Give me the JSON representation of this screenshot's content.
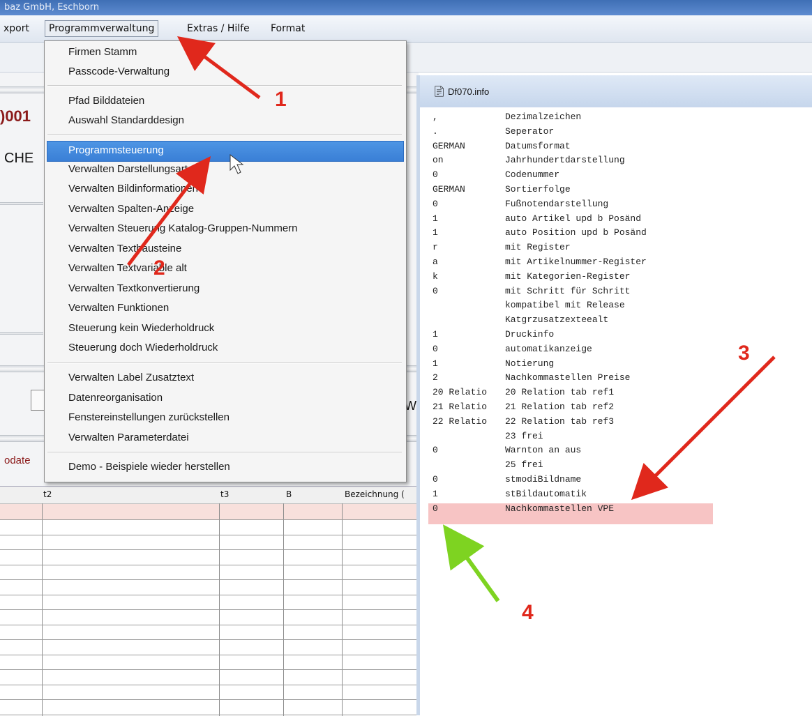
{
  "window_title": "baz GmbH, Eschborn",
  "menubar": {
    "items": [
      "xport",
      "Programmverwaltung",
      "Extras / Hilfe",
      "Format"
    ]
  },
  "left_form": {
    "code_fragment": ")001",
    "text_fragment": "CHE",
    "button_fragment": "W",
    "update_fragment": "odate",
    "grid_headers": [
      "t2",
      "t3",
      "B",
      "Bezeichnung ("
    ]
  },
  "dropdown": {
    "items": [
      "Firmen Stamm",
      "Passcode-Verwaltung",
      "Pfad Bilddateien",
      "Auswahl Standarddesign",
      "Programmsteuerung",
      "Verwalten  Darstellungsarten",
      "Verwalten Bildinformationen",
      "Verwalten Spalten-Anzeige",
      "Verwalten Steuerung Katalog-Gruppen-Nummern",
      "Verwalten Textbausteine",
      "Verwalten Textvariable alt",
      "Verwalten Textkonvertierung",
      "Verwalten Funktionen",
      "Steuerung kein Wiederholdruck",
      "Steuerung doch Wiederholdruck",
      "Verwalten Label Zusatztext",
      "Datenreorganisation",
      "Fenstereinstellungen zurückstellen",
      "Verwalten Parameterdatei",
      "Demo - Beispiele wieder herstellen"
    ],
    "highlighted": "Programmsteuerung"
  },
  "info_window": {
    "title": "Df070.info",
    "rows": [
      {
        "value": ",",
        "label": "Dezimalzeichen"
      },
      {
        "value": ".",
        "label": "Seperator"
      },
      {
        "value": "GERMAN",
        "label": "Datumsformat"
      },
      {
        "value": "on",
        "label": "Jahrhundertdarstellung"
      },
      {
        "value": "0",
        "label": "Codenummer"
      },
      {
        "value": "GERMAN",
        "label": "Sortierfolge"
      },
      {
        "value": "0",
        "label": "Fußnotendarstellung"
      },
      {
        "value": "1",
        "label": "auto Artikel upd b Posänd"
      },
      {
        "value": "1",
        "label": "auto Position upd b Posänd"
      },
      {
        "value": "r",
        "label": "mit Register"
      },
      {
        "value": "a",
        "label": "mit Artikelnummer-Register"
      },
      {
        "value": "k",
        "label": "mit Kategorien-Register"
      },
      {
        "value": "0",
        "label": "mit Schritt für Schritt"
      },
      {
        "value": "",
        "label": "kompatibel mit Release"
      },
      {
        "value": "",
        "label": "Katgrzusatzexteealt"
      },
      {
        "value": "1",
        "label": "Druckinfo"
      },
      {
        "value": "0",
        "label": "automatikanzeige"
      },
      {
        "value": "1",
        "label": "Notierung"
      },
      {
        "value": "2",
        "label": "Nachkommastellen Preise"
      },
      {
        "value": "20 Relatio",
        "label": "20 Relation tab ref1"
      },
      {
        "value": "21 Relatio",
        "label": "21 Relation tab ref2"
      },
      {
        "value": "22 Relatio",
        "label": "22 Relation tab ref3"
      },
      {
        "value": "",
        "label": "23 frei"
      },
      {
        "value": "0",
        "label": "Warnton an aus"
      },
      {
        "value": "",
        "label": "25 frei"
      },
      {
        "value": "0",
        "label": "stmodiBildname"
      },
      {
        "value": "1",
        "label": "stBildautomatik"
      },
      {
        "value": "0",
        "label": "Nachkommastellen VPE"
      }
    ]
  },
  "annotations": [
    "1",
    "2",
    "3",
    "4"
  ],
  "colors": {
    "red_arrow": "#e0281c",
    "green_arrow": "#7ed321",
    "highlight_row": "#f7c4c4",
    "menu_highlight": "#3a7fd6"
  }
}
